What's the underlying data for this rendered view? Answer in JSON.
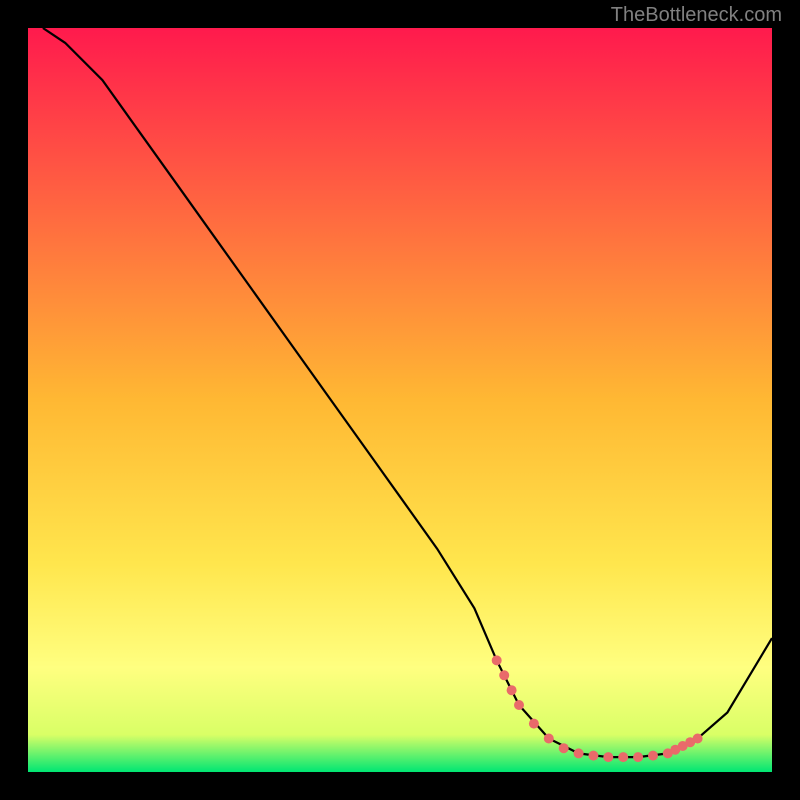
{
  "attribution": "TheBottleneck.com",
  "chart_data": {
    "type": "line",
    "title": "",
    "xlabel": "",
    "ylabel": "",
    "xlim": [
      0,
      100
    ],
    "ylim": [
      0,
      100
    ],
    "background_gradient": {
      "stops": [
        {
          "pos": 0,
          "color": "#ff1a4d"
        },
        {
          "pos": 50,
          "color": "#ffb833"
        },
        {
          "pos": 72,
          "color": "#ffe64d"
        },
        {
          "pos": 86,
          "color": "#ffff80"
        },
        {
          "pos": 95,
          "color": "#d9ff66"
        },
        {
          "pos": 100,
          "color": "#00e673"
        }
      ]
    },
    "series": [
      {
        "name": "bottleneck-curve",
        "color": "#000000",
        "x": [
          2,
          5,
          10,
          15,
          20,
          25,
          30,
          35,
          40,
          45,
          50,
          55,
          60,
          63,
          66,
          70,
          74,
          78,
          82,
          86,
          90,
          94,
          100
        ],
        "y": [
          100,
          98,
          93,
          86,
          79,
          72,
          65,
          58,
          51,
          44,
          37,
          30,
          22,
          15,
          9,
          4.5,
          2.5,
          2,
          2,
          2.5,
          4.5,
          8,
          18
        ]
      }
    ],
    "markers": {
      "name": "highlight-range",
      "color": "#e96a6a",
      "x": [
        63,
        64,
        65,
        66,
        68,
        70,
        72,
        74,
        76,
        78,
        80,
        82,
        84,
        86,
        87,
        88,
        89,
        90
      ],
      "y": [
        15,
        13,
        11,
        9,
        6.5,
        4.5,
        3.2,
        2.5,
        2.2,
        2,
        2,
        2,
        2.2,
        2.5,
        3,
        3.5,
        4,
        4.5
      ]
    }
  }
}
